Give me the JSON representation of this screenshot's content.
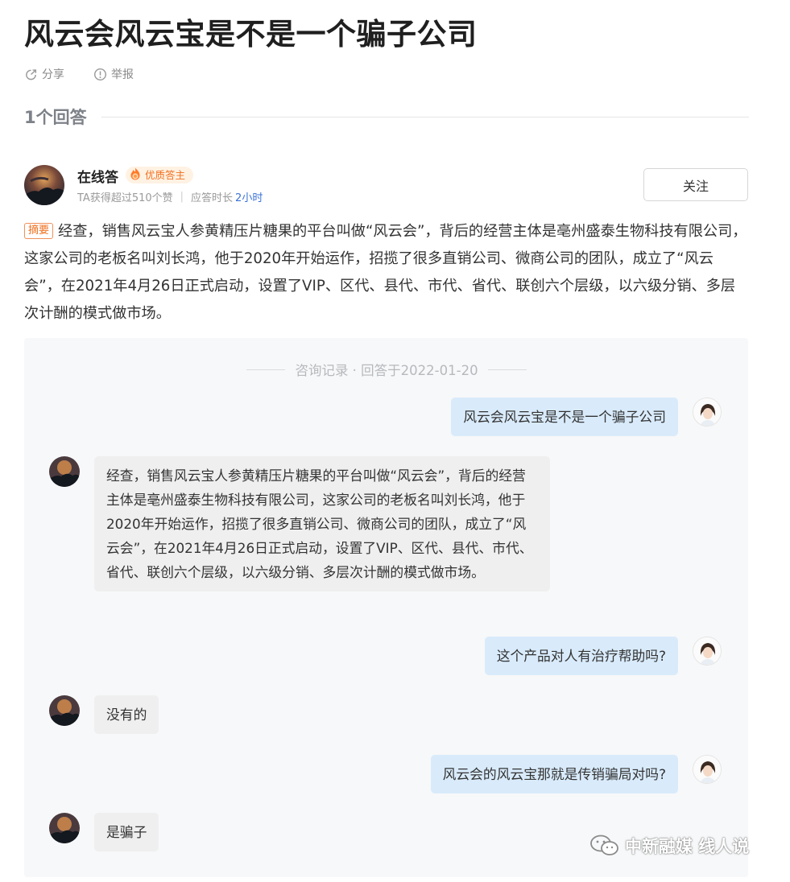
{
  "question": {
    "title": "风云会风云宝是不是一个骗子公司"
  },
  "actions": [
    {
      "label": "分享",
      "icon": "share-icon"
    },
    {
      "label": "举报",
      "icon": "report-icon"
    }
  ],
  "answers_header": "1个回答",
  "author": {
    "name": "在线答",
    "badge": "优质答主",
    "likes_text": "TA获得超过510个赞",
    "response_label": "应答时长",
    "response_value": "2小时",
    "follow_label": "关注"
  },
  "summary": {
    "tag": "摘要",
    "text": "经查，销售风云宝人参黄精压片糖果的平台叫做“风云会”，背后的经营主体是亳州盛泰生物科技有限公司，这家公司的老板名叫刘长鸿，他于2020年开始运作，招揽了很多直销公司、微商公司的团队，成立了“风云会”，在2021年4月26日正式启动，设置了VIP、区代、县代、市代、省代、联创六个层级，以六级分销、多层次计酬的模式做市场。"
  },
  "consult": {
    "record_label": "咨询记录 · 回答于2022-01-20",
    "messages": [
      {
        "role": "user",
        "text": "风云会风云宝是不是一个骗子公司"
      },
      {
        "role": "expert",
        "text": "经查，销售风云宝人参黄精压片糖果的平台叫做“风云会”，背后的经营主体是亳州盛泰生物科技有限公司，这家公司的老板名叫刘长鸿，他于2020年开始运作，招揽了很多直销公司、微商公司的团队，成立了“风云会”，在2021年4月26日正式启动，设置了VIP、区代、县代、市代、省代、联创六个层级，以六级分销、多层次计酬的模式做市场。"
      },
      {
        "role": "user",
        "text": "这个产品对人有治疗帮助吗?"
      },
      {
        "role": "expert",
        "text": "没有的"
      },
      {
        "role": "user",
        "text": "风云会的风云宝那就是传销骗局对吗?"
      },
      {
        "role": "expert",
        "text": "是骗子"
      }
    ]
  },
  "watermark": "中新融媒 线人说",
  "colors": {
    "accent_blue": "#3a72d6",
    "badge_orange": "#f06f1f",
    "user_bubble": "#d9ebfb",
    "expert_bubble": "#efefef",
    "panel_bg": "#f7f8f9"
  }
}
